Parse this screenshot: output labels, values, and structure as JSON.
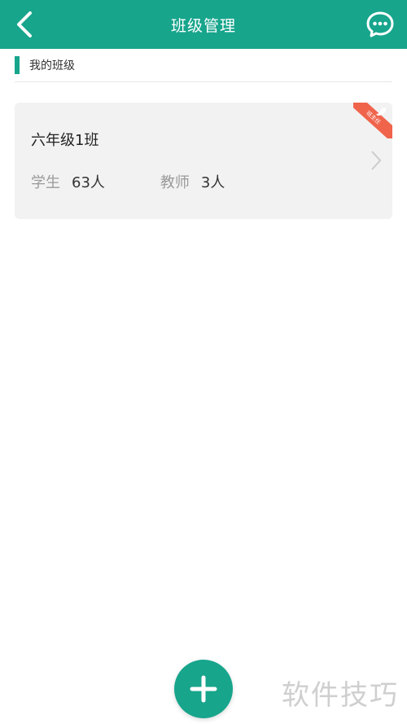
{
  "header": {
    "title": "班级管理",
    "back_icon": "back-chevron-icon",
    "chat_icon": "chat-bubble-icon"
  },
  "section": {
    "title": "我的班级"
  },
  "classes": [
    {
      "name": "六年级1班",
      "students_label": "学生",
      "students_value": "63人",
      "teachers_label": "教师",
      "teachers_value": "3人",
      "ribbon_text": "班主任"
    }
  ],
  "fab": {
    "icon": "plus-icon"
  },
  "watermark": "软件技巧",
  "colors": {
    "accent": "#17a58c",
    "ribbon": "#f0644c",
    "card_bg": "#f2f2f2"
  }
}
